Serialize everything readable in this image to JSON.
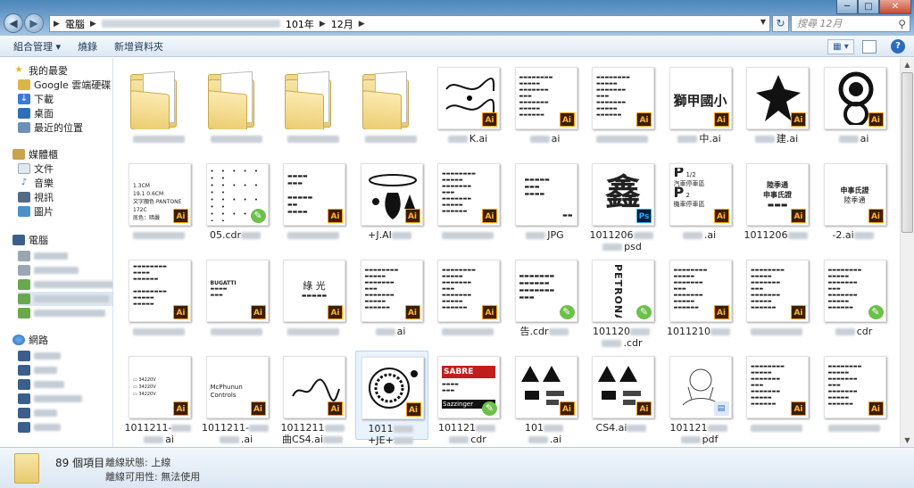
{
  "address": {
    "root": "電腦",
    "crumbs": [
      "101年",
      "12月"
    ],
    "search_placeholder": "搜尋 12月"
  },
  "toolbar": {
    "organize": "組合管理 ▾",
    "burn": "燒錄",
    "new_folder": "新增資料夾"
  },
  "nav": {
    "favorites": "我的最愛",
    "google_drive": "Google 雲端硬碟",
    "downloads": "下載",
    "desktop": "桌面",
    "recent": "最近的位置",
    "libraries": "媒體櫃",
    "documents": "文件",
    "music": "音樂",
    "videos": "視訊",
    "pictures": "圖片",
    "computer": "電腦",
    "network": "網路"
  },
  "files": [
    {
      "name": "",
      "type": "folder"
    },
    {
      "name": "",
      "type": "folder"
    },
    {
      "name": "",
      "type": "folder"
    },
    {
      "name": "",
      "type": "folder"
    },
    {
      "name": "K.ai",
      "type": "ai"
    },
    {
      "name": "ai",
      "type": "ai"
    },
    {
      "name": "",
      "type": "ai"
    },
    {
      "name": "中.ai",
      "type": "ai"
    },
    {
      "name": "建.ai",
      "type": "ai"
    },
    {
      "name": "ai",
      "type": "ai"
    },
    {
      "name": "",
      "type": "ai"
    },
    {
      "name": "05.cdr",
      "type": "cdr"
    },
    {
      "name": "",
      "type": "ai"
    },
    {
      "name": "+J.AI",
      "type": "ai"
    },
    {
      "name": "",
      "type": "ai"
    },
    {
      "name": "JPG",
      "type": "jpg"
    },
    {
      "name": "1011206",
      "line2": "psd",
      "type": "psd"
    },
    {
      "name": ".ai",
      "type": "ai"
    },
    {
      "name": "1011206",
      "type": "ai"
    },
    {
      "name": "-2.ai",
      "type": "ai"
    },
    {
      "name": "",
      "type": "ai"
    },
    {
      "name": "",
      "type": "ai"
    },
    {
      "name": "",
      "type": "ai"
    },
    {
      "name": "ai",
      "type": "ai"
    },
    {
      "name": "",
      "type": "ai"
    },
    {
      "name": "告.cdr",
      "type": "cdr"
    },
    {
      "name": "101120",
      "line2": ".cdr",
      "type": "cdr"
    },
    {
      "name": "1011210",
      "type": "ai"
    },
    {
      "name": "",
      "type": "ai"
    },
    {
      "name": "cdr",
      "type": "cdr"
    },
    {
      "name": "1011211-",
      "line2": "ai",
      "type": "ai"
    },
    {
      "name": "1011211-",
      "line2": ".ai",
      "type": "ai"
    },
    {
      "name": "1011211",
      "line2": "曲CS4.ai",
      "type": "ai"
    },
    {
      "name": "1011",
      "line2": "+JE+",
      "line3": "ai",
      "type": "ai"
    },
    {
      "name": "101121",
      "line2": "cdr",
      "type": "cdr"
    },
    {
      "name": "101",
      "line2": ".ai",
      "type": "ai"
    },
    {
      "name": "CS4.ai",
      "type": "ai"
    },
    {
      "name": "101121",
      "line2": "pdf",
      "type": "pdf"
    },
    {
      "name": "",
      "type": "ai"
    },
    {
      "name": "",
      "type": "ai"
    }
  ],
  "thumb_text": {
    "lion": "獅甲國小",
    "parking1": "P 1/2 汽車停車區",
    "parking2": "P 2 機車停車區",
    "petronas": "PETRONAS",
    "pantone": "PANTONE 172C",
    "spec1": "1.3CM",
    "spec2": "19.1",
    "spec3": "0.6CM",
    "spec_lines": [
      "文字顏色",
      "底色：暗嚴",
      "數量12000個"
    ],
    "sabre": "SABRE",
    "sabre_sub": "Sazzinger",
    "mcphun": "McPhunun Controls",
    "green_light": "綠 光"
  },
  "status": {
    "item_count": "89 個項目",
    "offline_status": "離線狀態: 上線",
    "offline_avail": "離線可用性: 無法使用"
  },
  "badges": {
    "ai": "Ai",
    "ps": "Ps",
    "cdr": "✎"
  }
}
